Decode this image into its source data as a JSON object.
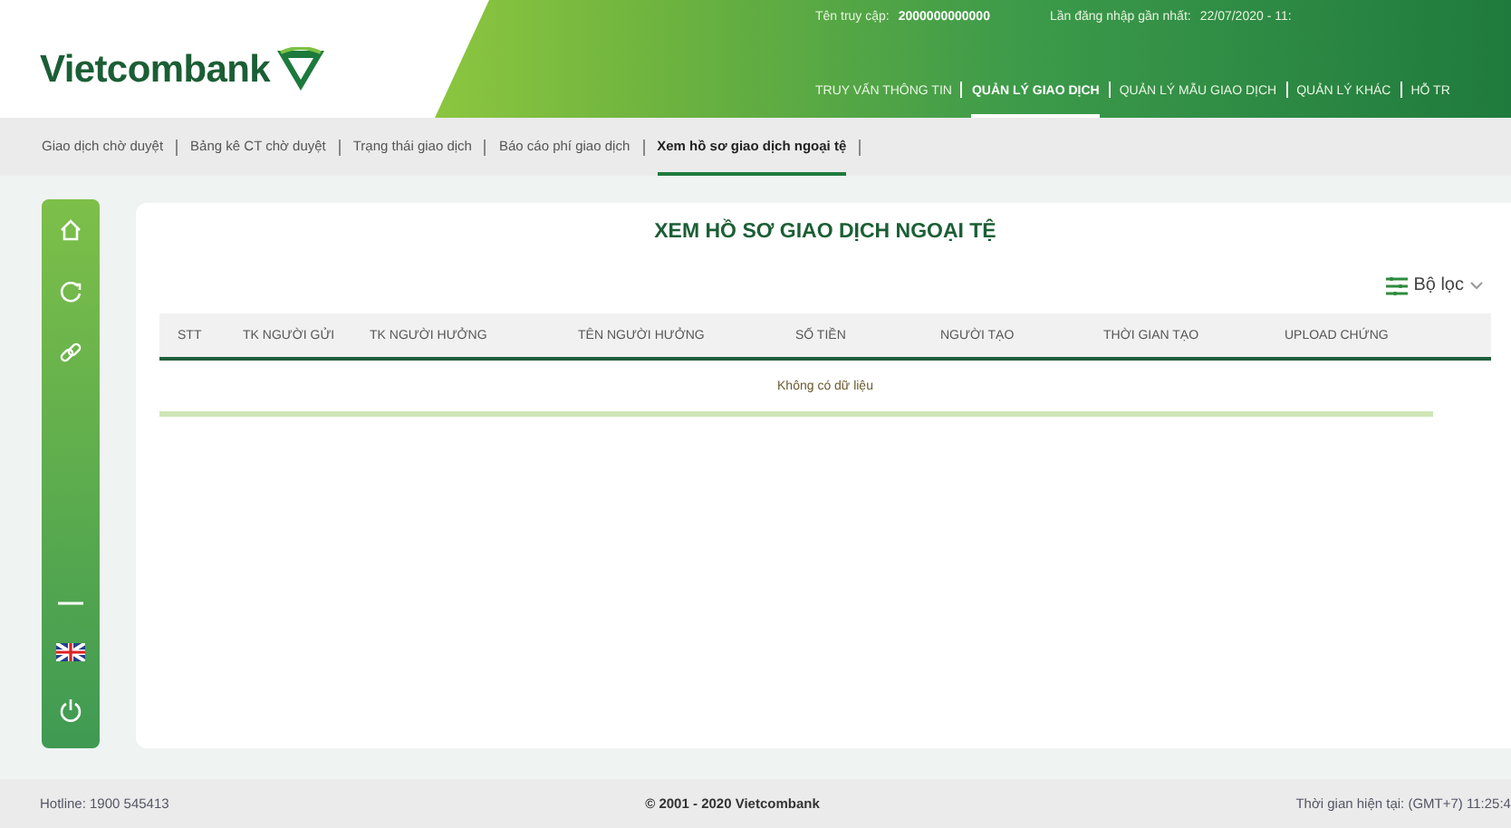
{
  "header": {
    "logo": "Vietcombank",
    "user_label": "Tên truy cập:",
    "user_value": "2000000000000",
    "last_login_label": "Lần đăng nhập gần nhất:",
    "last_login_value": "22/07/2020 - 11:",
    "nav": [
      {
        "label": "TRUY VẤN THÔNG TIN",
        "selected": false
      },
      {
        "label": "QUẢN LÝ GIAO DỊCH",
        "selected": true
      },
      {
        "label": "QUẢN LÝ MẪU GIAO DỊCH",
        "selected": false
      },
      {
        "label": "QUẢN LÝ KHÁC",
        "selected": false
      },
      {
        "label": "HỖ TR",
        "selected": false
      }
    ]
  },
  "subnav": [
    {
      "label": "Giao dịch chờ duyệt",
      "selected": false
    },
    {
      "label": "Bảng kê CT chờ duyệt",
      "selected": false
    },
    {
      "label": "Trạng thái giao dịch",
      "selected": false
    },
    {
      "label": "Báo cáo phí giao dịch",
      "selected": false
    },
    {
      "label": "Xem hồ sơ giao dịch ngoại tệ",
      "selected": true
    }
  ],
  "sidebar": {
    "items": [
      {
        "kind": "home"
      },
      {
        "kind": "refresh"
      },
      {
        "kind": "link"
      },
      {
        "kind": "collapse"
      },
      {
        "kind": "language"
      },
      {
        "kind": "power"
      }
    ]
  },
  "page_title": "XEM HỒ SƠ GIAO DỊCH NGOẠI TỆ",
  "filter": {
    "label": "Bộ lọc"
  },
  "table": {
    "columns": [
      "STT",
      "TK NGƯỜI GỬI",
      "TK NGƯỜI HƯỞNG",
      "TÊN NGƯỜI HƯỞNG",
      "SỐ TIỀN",
      "NGƯỜI TẠO",
      "THỜI GIAN TẠO",
      "UPLOAD CHỨNG"
    ],
    "empty_message": "Không có dữ liệu"
  },
  "footer": {
    "hotline": "Hotline: 1900 545413",
    "copyright": "© 2001 - 2020 Vietcombank",
    "time": "Thời gian hiện tại: (GMT+7) 11:25:4"
  }
}
